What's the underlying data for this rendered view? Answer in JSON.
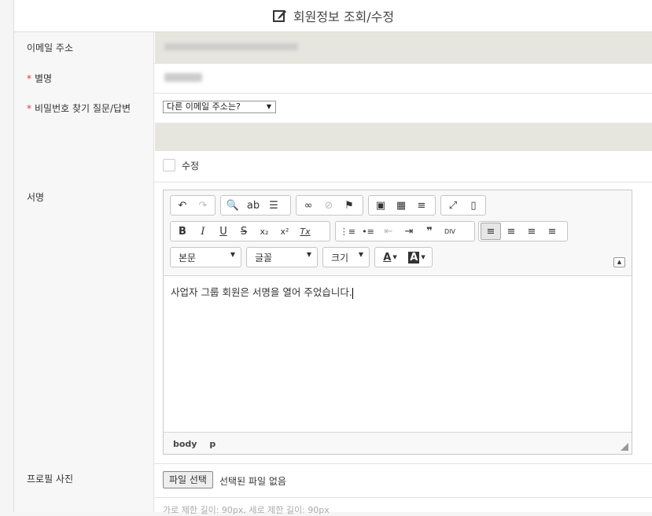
{
  "header": {
    "title": "회원정보 조회/수정",
    "icon": "edit-icon"
  },
  "fields": {
    "email": {
      "label": "이메일 주소"
    },
    "nickname": {
      "label": "별명",
      "required_mark": "*"
    },
    "password_question": {
      "label": "비밀번호 찾기 질문/답변",
      "required_mark": "*",
      "selected": "다른 이메일 주소는?",
      "modify_label": "수정"
    },
    "signature": {
      "label": "서명",
      "content": "사업자 그룹 회원은 서명을 열어 주었습니다.",
      "path": [
        "body",
        "p"
      ]
    },
    "profile_photo": {
      "label": "프로필 사진",
      "file_button": "파일 선택",
      "file_status": "선택된 파일 없음",
      "hint": "가로 제한 길이: 90px, 세로 제한 길이: 90px"
    }
  },
  "editor": {
    "toolbar": {
      "undo": "↶",
      "redo": "↷",
      "find": "🔍",
      "replace": "ab",
      "select_all": "☰",
      "link": "∞",
      "unlink": "⊘",
      "anchor": "⚑",
      "image": "▣",
      "table": "▦",
      "hr": "≡",
      "maximize": "⤢",
      "source_view": "▯",
      "bold": "B",
      "italic": "I",
      "underline": "U",
      "strike": "S",
      "subscript": "x₂",
      "superscript": "x²",
      "remove_format": "Tx",
      "numbered_list": "⋮≡",
      "bulleted_list": "•≡",
      "outdent": "⇤",
      "indent": "⇥",
      "blockquote": "❞",
      "div": "DIV",
      "align_left": "≡",
      "align_center": "≡",
      "align_right": "≡",
      "justify": "≡"
    },
    "combos": {
      "format": "본문",
      "font": "글꼴",
      "size": "크기"
    },
    "text_color": "A",
    "bg_color": "A"
  }
}
